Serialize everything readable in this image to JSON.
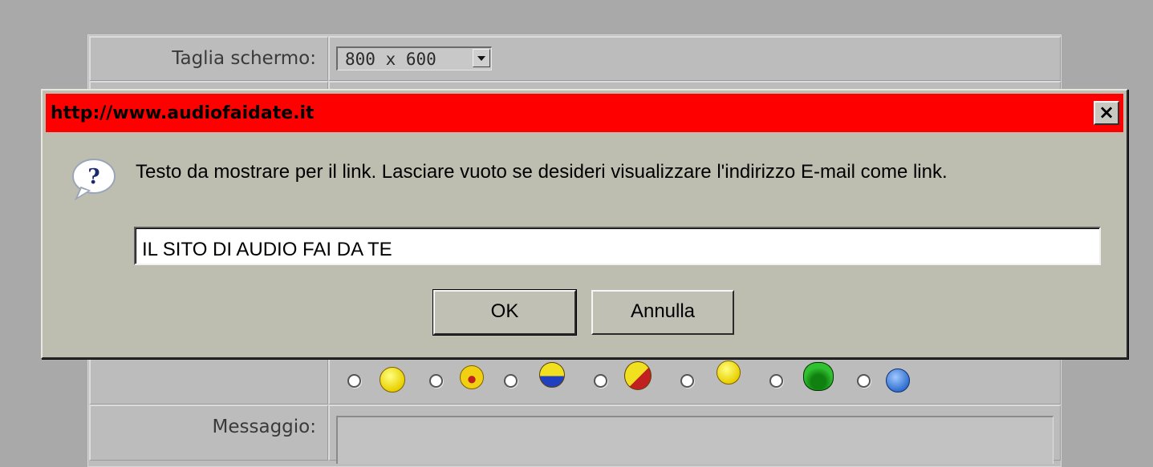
{
  "form": {
    "screen_size_label": "Taglia schermo:",
    "screen_size_value": "800 x 600",
    "message_label": "Messaggio:",
    "smileys": [
      {
        "name": "smiley-grin-icon",
        "color": "#f0e020"
      },
      {
        "name": "smiley-shout-icon",
        "color": "#f0d010"
      },
      {
        "name": "smiley-reading-icon",
        "color": "#f0e020"
      },
      {
        "name": "smiley-guitar-icon",
        "color": "#f0e020"
      },
      {
        "name": "smiley-dance-icon",
        "color": "#f0e020"
      },
      {
        "name": "smiley-frog-icon",
        "color": "#20a020"
      },
      {
        "name": "smiley-blue-icon",
        "color": "#4080e0"
      }
    ]
  },
  "dialog": {
    "title": "http://www.audiofaidate.it",
    "close_label": "×",
    "prompt": "Testo da mostrare per il link. Lasciare vuoto se desideri visualizzare l'indirizzo E-mail come link.",
    "input_value": "IL SITO DI AUDIO FAI DA TE",
    "ok_label": "OK",
    "cancel_label": "Annulla",
    "icon": "question-icon",
    "title_color": "#ff0000"
  }
}
